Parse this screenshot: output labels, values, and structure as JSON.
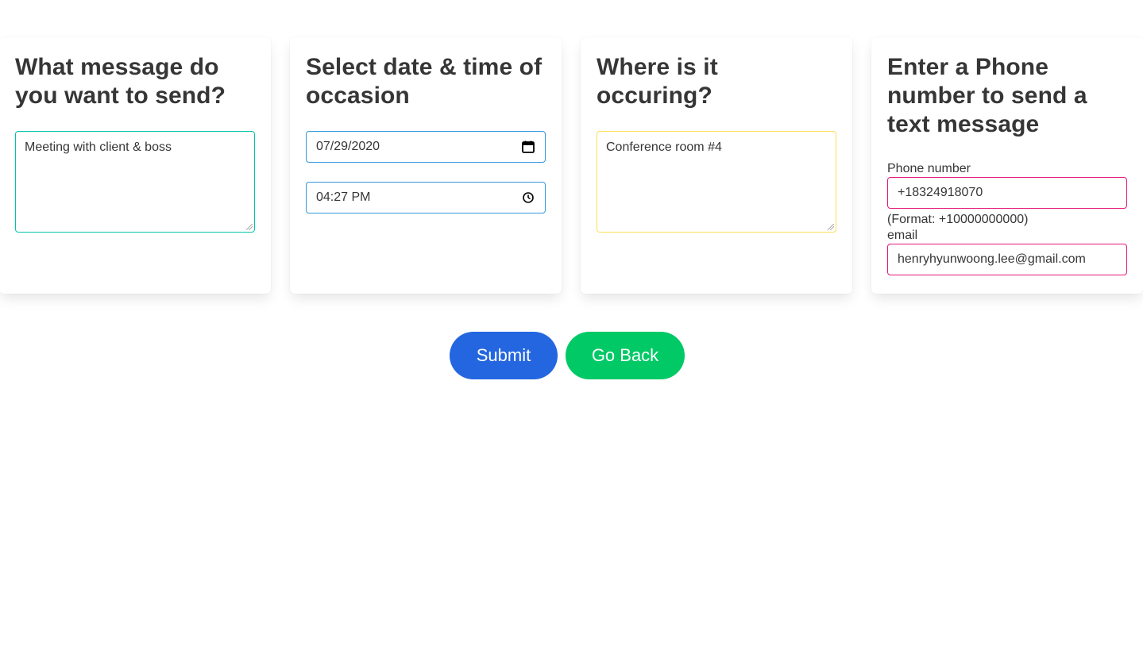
{
  "colors": {
    "submit_bg": "#2366e0",
    "back_bg": "#00c966",
    "message_border": "#00c4a7",
    "datetime_border": "#3298dc",
    "location_border": "#ffdd57",
    "contact_border": "#e6177b"
  },
  "message_card": {
    "title": "What message do you want to send?",
    "value": "Meeting with client & boss"
  },
  "datetime_card": {
    "title": "Select date & time of occasion",
    "date_value": "07/29/2020",
    "time_value": "04:27 PM",
    "date_icon": "calendar-icon",
    "time_icon": "clock-icon"
  },
  "location_card": {
    "title": "Where is it occuring?",
    "value": "Conference room #4"
  },
  "contact_card": {
    "title": "Enter a Phone number to send a text message",
    "phone_label": "Phone number",
    "phone_value": "+18324918070",
    "phone_help": "(Format: +10000000000)",
    "email_label": "email",
    "email_value": "henryhyunwoong.lee@gmail.com"
  },
  "actions": {
    "submit_label": "Submit",
    "back_label": "Go Back"
  }
}
